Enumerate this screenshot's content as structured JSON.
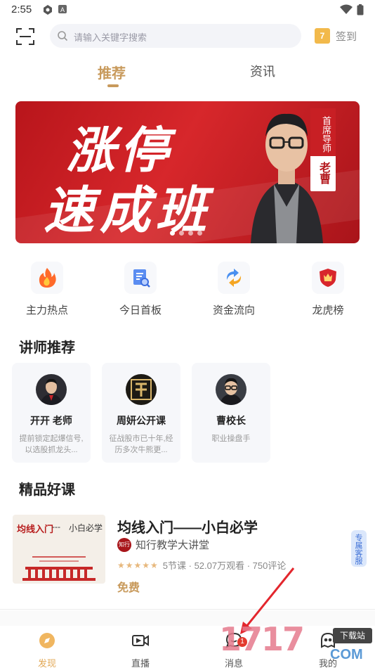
{
  "status_bar": {
    "time": "2:55"
  },
  "header": {
    "search_placeholder": "请输入关键字搜索",
    "checkin_day": "7",
    "checkin_label": "签到"
  },
  "tabs": [
    {
      "label": "推荐",
      "active": true
    },
    {
      "label": "资讯",
      "active": false
    }
  ],
  "banner": {
    "title_line1": "涨停",
    "title_line2": "速成班",
    "badge_top": "首席导师",
    "badge_bottom": "老曹",
    "dots": 4,
    "active_dot": 0
  },
  "quick_entries": [
    {
      "label": "主力热点",
      "icon": "flame-icon"
    },
    {
      "label": "今日首板",
      "icon": "document-search-icon"
    },
    {
      "label": "资金流向",
      "icon": "flow-arrows-icon"
    },
    {
      "label": "龙虎榜",
      "icon": "dragon-shield-icon"
    }
  ],
  "teachers_section": {
    "title": "讲师推荐",
    "items": [
      {
        "name": "开开 老师",
        "desc": "提前锁定起爆信号,以选股抓龙头..."
      },
      {
        "name": "周妍公开课",
        "desc": "征战股市已十年,经历多次牛熊更..."
      },
      {
        "name": "曹校长",
        "desc": "职业操盘手"
      }
    ]
  },
  "courses_section": {
    "title": "精品好课",
    "items": [
      {
        "thumb_text_left": "均线入门",
        "thumb_text_dash": "---",
        "thumb_text_right": "小白必学",
        "title": "均线入门——小白必学",
        "author_logo": "知行",
        "author": "知行教学大讲堂",
        "rating_stars": 5,
        "meta": "5节课 · 52.07万观看 · 750评论",
        "price": "免费"
      }
    ]
  },
  "float_button": {
    "label": "专属客服"
  },
  "bottom_nav": [
    {
      "label": "发现",
      "icon": "compass-icon",
      "active": true
    },
    {
      "label": "直播",
      "icon": "video-icon",
      "active": false
    },
    {
      "label": "消息",
      "icon": "chat-icon",
      "active": false,
      "badge": "1"
    },
    {
      "label": "我的",
      "icon": "user-icon",
      "active": false
    }
  ],
  "watermark": {
    "text": "1717",
    "tag": "下载站",
    "suffix": "COM"
  },
  "colors": {
    "accent": "#c89a5c",
    "banner_red": "#c81f24",
    "nav_active": "#e2a856"
  }
}
